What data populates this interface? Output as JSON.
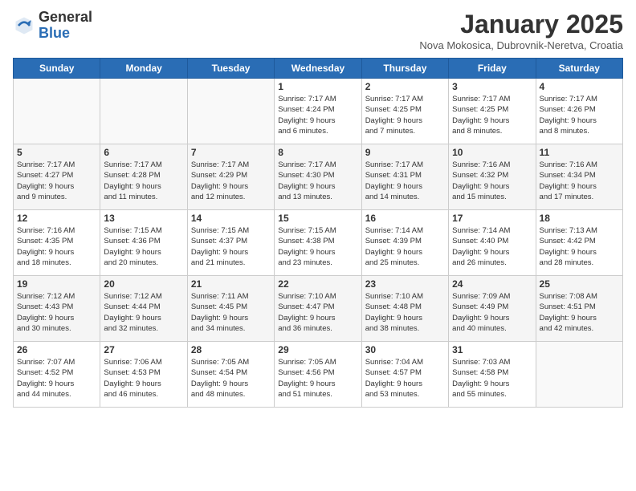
{
  "header": {
    "logo_general": "General",
    "logo_blue": "Blue",
    "month": "January 2025",
    "location": "Nova Mokosica, Dubrovnik-Neretva, Croatia"
  },
  "days_of_week": [
    "Sunday",
    "Monday",
    "Tuesday",
    "Wednesday",
    "Thursday",
    "Friday",
    "Saturday"
  ],
  "weeks": [
    [
      {
        "num": "",
        "info": ""
      },
      {
        "num": "",
        "info": ""
      },
      {
        "num": "",
        "info": ""
      },
      {
        "num": "1",
        "info": "Sunrise: 7:17 AM\nSunset: 4:24 PM\nDaylight: 9 hours\nand 6 minutes."
      },
      {
        "num": "2",
        "info": "Sunrise: 7:17 AM\nSunset: 4:25 PM\nDaylight: 9 hours\nand 7 minutes."
      },
      {
        "num": "3",
        "info": "Sunrise: 7:17 AM\nSunset: 4:25 PM\nDaylight: 9 hours\nand 8 minutes."
      },
      {
        "num": "4",
        "info": "Sunrise: 7:17 AM\nSunset: 4:26 PM\nDaylight: 9 hours\nand 8 minutes."
      }
    ],
    [
      {
        "num": "5",
        "info": "Sunrise: 7:17 AM\nSunset: 4:27 PM\nDaylight: 9 hours\nand 9 minutes."
      },
      {
        "num": "6",
        "info": "Sunrise: 7:17 AM\nSunset: 4:28 PM\nDaylight: 9 hours\nand 11 minutes."
      },
      {
        "num": "7",
        "info": "Sunrise: 7:17 AM\nSunset: 4:29 PM\nDaylight: 9 hours\nand 12 minutes."
      },
      {
        "num": "8",
        "info": "Sunrise: 7:17 AM\nSunset: 4:30 PM\nDaylight: 9 hours\nand 13 minutes."
      },
      {
        "num": "9",
        "info": "Sunrise: 7:17 AM\nSunset: 4:31 PM\nDaylight: 9 hours\nand 14 minutes."
      },
      {
        "num": "10",
        "info": "Sunrise: 7:16 AM\nSunset: 4:32 PM\nDaylight: 9 hours\nand 15 minutes."
      },
      {
        "num": "11",
        "info": "Sunrise: 7:16 AM\nSunset: 4:34 PM\nDaylight: 9 hours\nand 17 minutes."
      }
    ],
    [
      {
        "num": "12",
        "info": "Sunrise: 7:16 AM\nSunset: 4:35 PM\nDaylight: 9 hours\nand 18 minutes."
      },
      {
        "num": "13",
        "info": "Sunrise: 7:15 AM\nSunset: 4:36 PM\nDaylight: 9 hours\nand 20 minutes."
      },
      {
        "num": "14",
        "info": "Sunrise: 7:15 AM\nSunset: 4:37 PM\nDaylight: 9 hours\nand 21 minutes."
      },
      {
        "num": "15",
        "info": "Sunrise: 7:15 AM\nSunset: 4:38 PM\nDaylight: 9 hours\nand 23 minutes."
      },
      {
        "num": "16",
        "info": "Sunrise: 7:14 AM\nSunset: 4:39 PM\nDaylight: 9 hours\nand 25 minutes."
      },
      {
        "num": "17",
        "info": "Sunrise: 7:14 AM\nSunset: 4:40 PM\nDaylight: 9 hours\nand 26 minutes."
      },
      {
        "num": "18",
        "info": "Sunrise: 7:13 AM\nSunset: 4:42 PM\nDaylight: 9 hours\nand 28 minutes."
      }
    ],
    [
      {
        "num": "19",
        "info": "Sunrise: 7:12 AM\nSunset: 4:43 PM\nDaylight: 9 hours\nand 30 minutes."
      },
      {
        "num": "20",
        "info": "Sunrise: 7:12 AM\nSunset: 4:44 PM\nDaylight: 9 hours\nand 32 minutes."
      },
      {
        "num": "21",
        "info": "Sunrise: 7:11 AM\nSunset: 4:45 PM\nDaylight: 9 hours\nand 34 minutes."
      },
      {
        "num": "22",
        "info": "Sunrise: 7:10 AM\nSunset: 4:47 PM\nDaylight: 9 hours\nand 36 minutes."
      },
      {
        "num": "23",
        "info": "Sunrise: 7:10 AM\nSunset: 4:48 PM\nDaylight: 9 hours\nand 38 minutes."
      },
      {
        "num": "24",
        "info": "Sunrise: 7:09 AM\nSunset: 4:49 PM\nDaylight: 9 hours\nand 40 minutes."
      },
      {
        "num": "25",
        "info": "Sunrise: 7:08 AM\nSunset: 4:51 PM\nDaylight: 9 hours\nand 42 minutes."
      }
    ],
    [
      {
        "num": "26",
        "info": "Sunrise: 7:07 AM\nSunset: 4:52 PM\nDaylight: 9 hours\nand 44 minutes."
      },
      {
        "num": "27",
        "info": "Sunrise: 7:06 AM\nSunset: 4:53 PM\nDaylight: 9 hours\nand 46 minutes."
      },
      {
        "num": "28",
        "info": "Sunrise: 7:05 AM\nSunset: 4:54 PM\nDaylight: 9 hours\nand 48 minutes."
      },
      {
        "num": "29",
        "info": "Sunrise: 7:05 AM\nSunset: 4:56 PM\nDaylight: 9 hours\nand 51 minutes."
      },
      {
        "num": "30",
        "info": "Sunrise: 7:04 AM\nSunset: 4:57 PM\nDaylight: 9 hours\nand 53 minutes."
      },
      {
        "num": "31",
        "info": "Sunrise: 7:03 AM\nSunset: 4:58 PM\nDaylight: 9 hours\nand 55 minutes."
      },
      {
        "num": "",
        "info": ""
      }
    ]
  ]
}
